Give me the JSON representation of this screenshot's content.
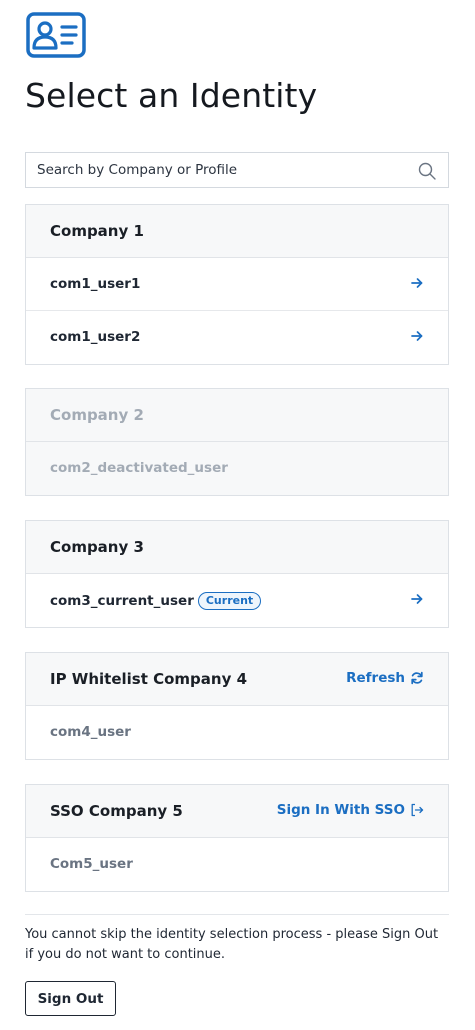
{
  "header": {
    "logo_icon": "id-card-icon",
    "title": "Select an Identity"
  },
  "search": {
    "placeholder": "Search by Company or Profile",
    "value": "",
    "icon": "search-icon"
  },
  "companies": [
    {
      "name": "Company 1",
      "state": "active",
      "users": [
        {
          "label": "com1_user1",
          "action_icon": "arrow-right-icon"
        },
        {
          "label": "com1_user2",
          "action_icon": "arrow-right-icon"
        }
      ]
    },
    {
      "name": "Company 2",
      "state": "disabled",
      "users": [
        {
          "label": "com2_deactivated_user"
        }
      ]
    },
    {
      "name": "Company 3",
      "state": "active",
      "users": [
        {
          "label": "com3_current_user",
          "badge": "Current",
          "action_icon": "arrow-right-icon"
        }
      ]
    },
    {
      "name": "IP Whitelist Company 4",
      "state": "restricted",
      "action": {
        "label": "Refresh",
        "icon": "refresh-icon"
      },
      "users": [
        {
          "label": "com4_user"
        }
      ]
    },
    {
      "name": "SSO Company 5",
      "state": "sso",
      "action": {
        "label": "Sign In With SSO",
        "icon": "sign-in-icon"
      },
      "users": [
        {
          "label": "Com5_user"
        }
      ]
    }
  ],
  "footer": {
    "notice": "You cannot skip the identity selection process - please Sign Out if you do not want to continue.",
    "signout_label": "Sign Out"
  },
  "colors": {
    "accent": "#1b6ec2",
    "text": "#1f2733",
    "muted": "#a3abb5",
    "border": "#dde1e6",
    "header_bg": "#f7f8f9"
  }
}
